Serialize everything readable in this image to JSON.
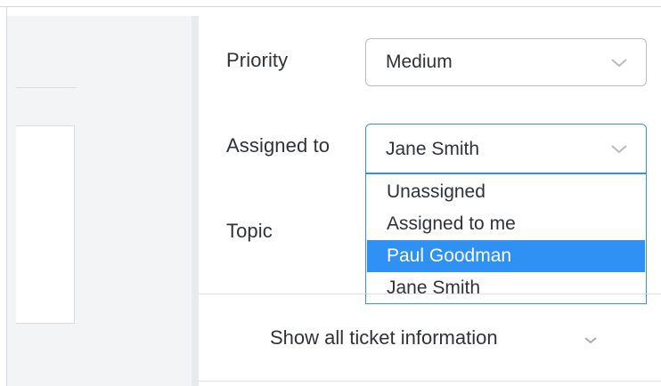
{
  "form": {
    "priority": {
      "label": "Priority",
      "value": "Medium",
      "icon": "chevron-down-icon"
    },
    "assigned_to": {
      "label": "Assigned to",
      "value": "Jane Smith",
      "icon": "chevron-down-icon",
      "open": true,
      "options": [
        {
          "label": "Unassigned",
          "highlighted": false
        },
        {
          "label": "Assigned to me",
          "highlighted": false
        },
        {
          "label": "Paul Goodman",
          "highlighted": true
        },
        {
          "label": "Jane Smith",
          "highlighted": false
        }
      ]
    },
    "topic": {
      "label": "Topic"
    }
  },
  "footer": {
    "show_all_label": "Show all ticket information",
    "icon": "chevron-down-icon"
  },
  "colors": {
    "accent": "#2e91f3",
    "focus_border": "#3b8ed8",
    "text": "#2f3237",
    "left_pane_bg": "#f3f4f6"
  }
}
